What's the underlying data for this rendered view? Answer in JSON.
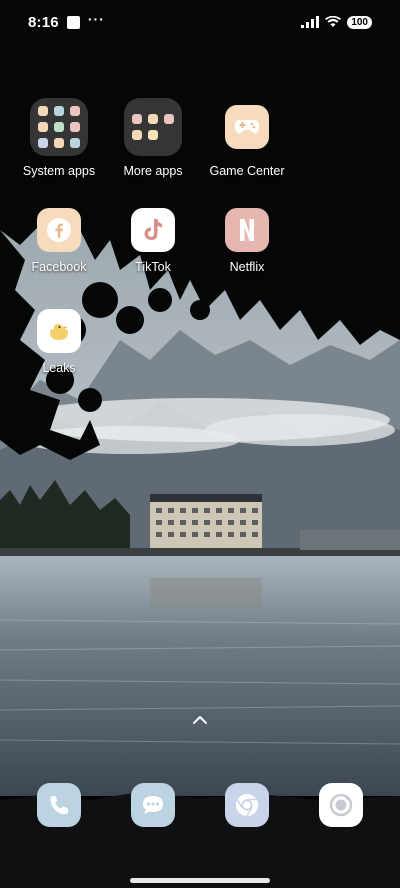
{
  "status_bar": {
    "time": "8:16",
    "battery": "100"
  },
  "apps": {
    "system_apps": {
      "label": "System apps",
      "icon": "folder-icon"
    },
    "more_apps": {
      "label": "More apps",
      "icon": "folder-icon"
    },
    "game_center": {
      "label": "Game Center",
      "icon": "gamepad-icon"
    },
    "facebook": {
      "label": "Facebook",
      "icon": "facebook-icon"
    },
    "tiktok": {
      "label": "TikTok",
      "icon": "tiktok-icon"
    },
    "netflix": {
      "label": "Netflix",
      "icon": "netflix-icon"
    },
    "leaks": {
      "label": "Leaks",
      "icon": "duck-icon"
    }
  },
  "dock": [
    {
      "name": "phone",
      "icon": "phone-icon"
    },
    {
      "name": "messages",
      "icon": "chat-icon"
    },
    {
      "name": "browser",
      "icon": "chrome-icon"
    },
    {
      "name": "camera",
      "icon": "camera-icon"
    }
  ],
  "colors": {
    "icon_peach": "#f6dcbc",
    "icon_pink": "#e6b7b0",
    "dock_blue": "#bcd3e1",
    "dock_lavender": "#c9d4ea"
  }
}
